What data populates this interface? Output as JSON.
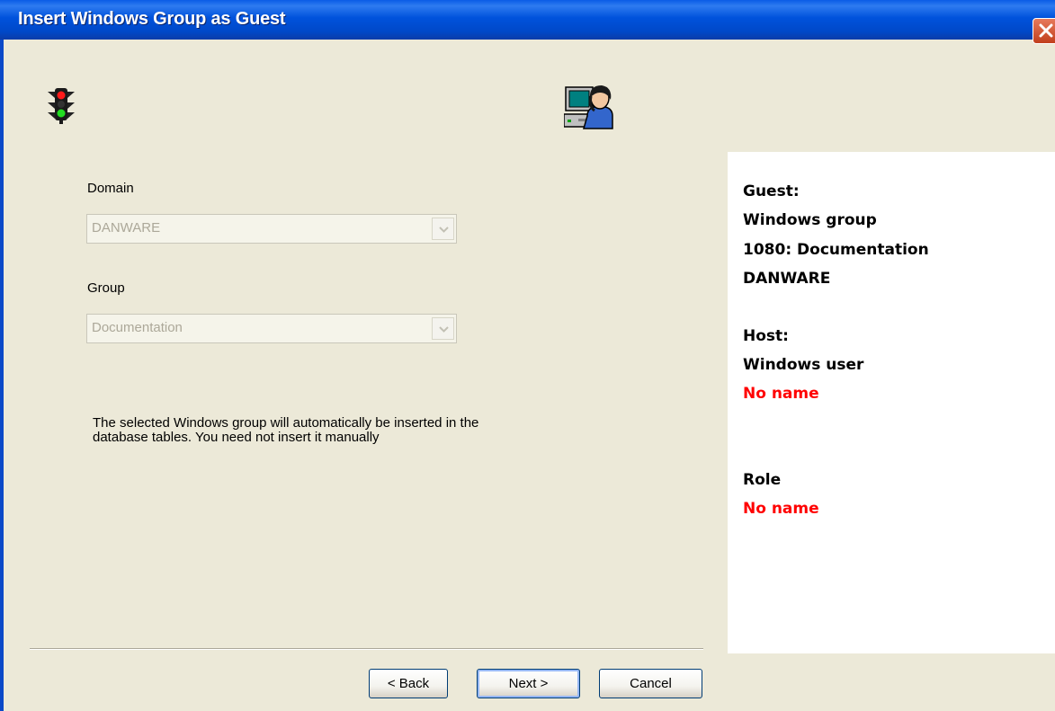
{
  "window": {
    "title": "Insert Windows Group as Guest"
  },
  "icons": {
    "status": "traffic-light-icon",
    "user": "user-computer-icon",
    "close": "close-icon"
  },
  "form": {
    "domain_label": "Domain",
    "domain_value": "DANWARE",
    "group_label": "Group",
    "group_value": "Documentation",
    "info_text": "The selected Windows group will automatically be inserted in the database tables. You need not insert it manually"
  },
  "summary": {
    "guest_heading": "Guest:",
    "guest_type": "Windows group",
    "guest_name": "1080: Documentation",
    "guest_domain": "DANWARE",
    "host_heading": "Host:",
    "host_type": "Windows user",
    "host_name": "No name",
    "role_heading": "Role",
    "role_name": "No name"
  },
  "buttons": {
    "back": "< Back",
    "next": "Next >",
    "cancel": "Cancel"
  },
  "colors": {
    "titlebar": "#0052dc",
    "dialog_bg": "#ece9d8",
    "missing_value": "#ff0000",
    "disabled_text": "#aca899"
  }
}
